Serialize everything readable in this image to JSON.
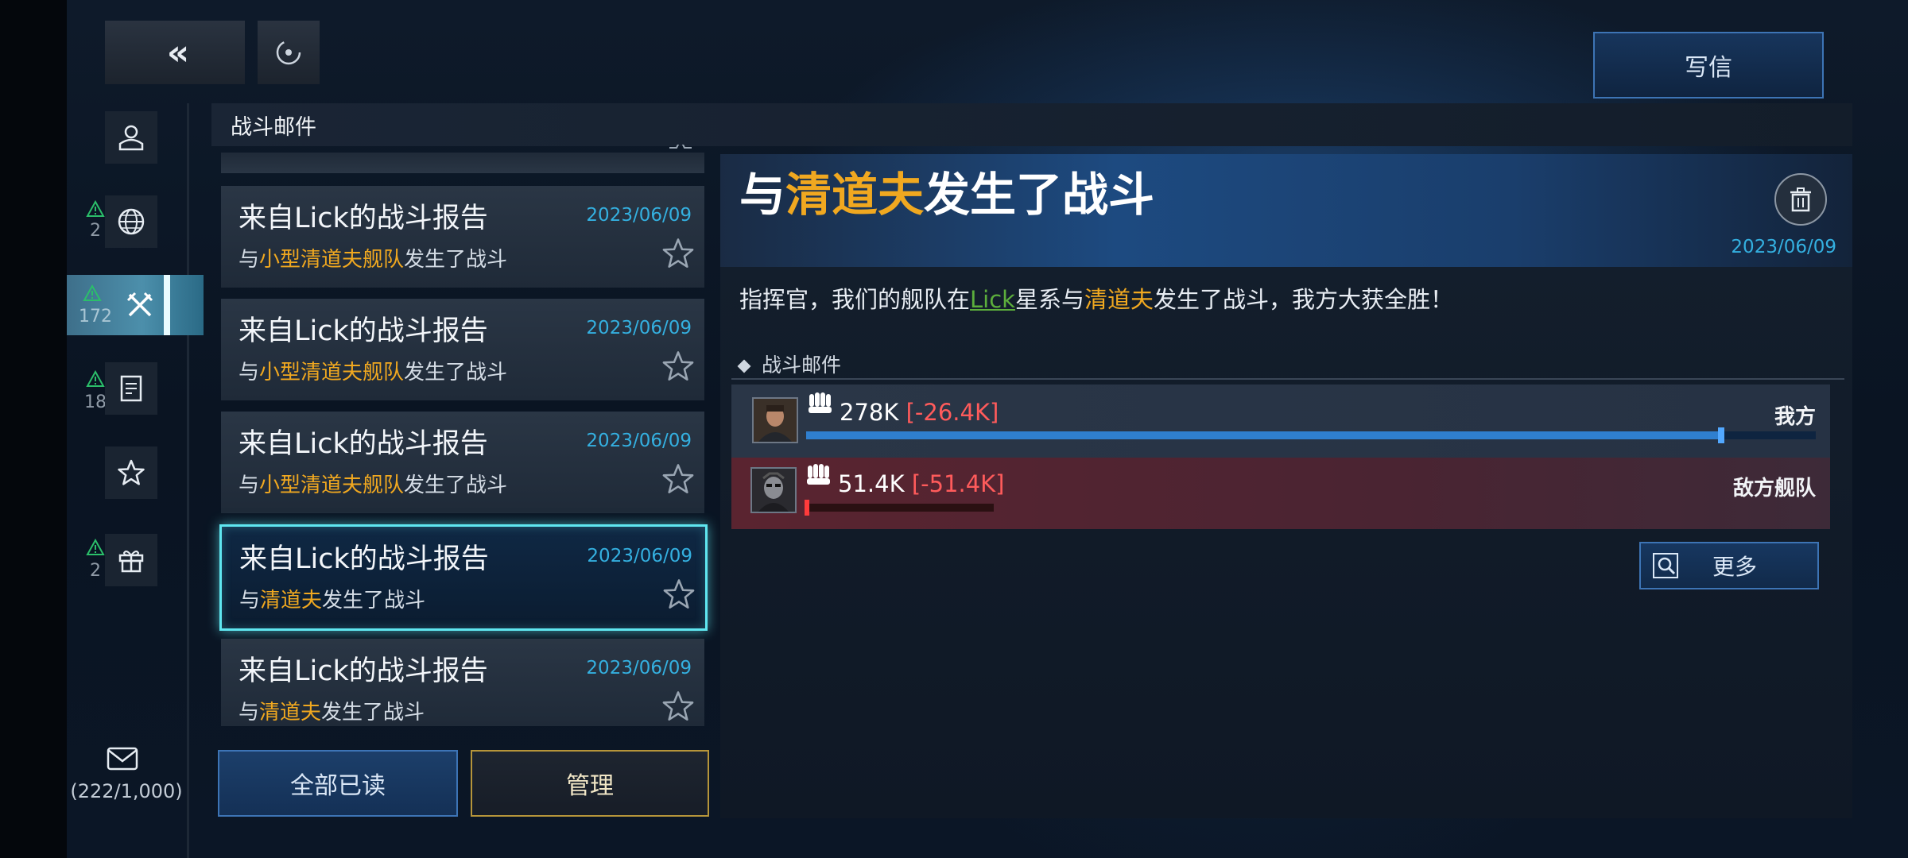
{
  "top": {
    "back_label": "«",
    "write_label": "写信"
  },
  "nav": {
    "badges": [
      {
        "count": "2"
      },
      {
        "count": "172"
      },
      {
        "count": "18"
      },
      {
        "count": "2"
      }
    ],
    "mail_count": "(222/1,000)"
  },
  "header": {
    "title": "战斗邮件"
  },
  "list": [
    {
      "title": "来自Lick的战斗报告",
      "date": "2023/06/09",
      "pre": "与",
      "hl": "小型清道夫舰队",
      "post": "发生了战斗"
    },
    {
      "title": "来自Lick的战斗报告",
      "date": "2023/06/09",
      "pre": "与",
      "hl": "小型清道夫舰队",
      "post": "发生了战斗"
    },
    {
      "title": "来自Lick的战斗报告",
      "date": "2023/06/09",
      "pre": "与",
      "hl": "小型清道夫舰队",
      "post": "发生了战斗"
    },
    {
      "title": "来自Lick的战斗报告",
      "date": "2023/06/09",
      "pre": "与",
      "hl": "清道夫",
      "post": "发生了战斗"
    },
    {
      "title": "来自Lick的战斗报告",
      "date": "2023/06/09",
      "pre": "与",
      "hl": "清道夫",
      "post": "发生了战斗"
    }
  ],
  "buttons": {
    "read_all": "全部已读",
    "manage": "管理",
    "more": "更多"
  },
  "detail": {
    "title_pre": "与",
    "title_hl": "清道夫",
    "title_post": "发生了战斗",
    "date": "2023/06/09",
    "body_1": "指挥官，我们的舰队在",
    "body_link": "Lick",
    "body_2": "星系与",
    "body_hl": "清道夫",
    "body_3": "发生了战斗，我方大获全胜！",
    "section": "战斗邮件"
  },
  "battle": {
    "ally": {
      "power": "278K",
      "loss": "[-26.4K]",
      "label": "我方",
      "remaining_fraction": 0.905
    },
    "enemy": {
      "power": "51.4K",
      "loss": "[-51.4K]",
      "label": "敌方舰队",
      "remaining_fraction": 0.0
    }
  },
  "colors": {
    "highlight": "#f0a820",
    "date": "#34b0e0",
    "loss": "#ff5b5b",
    "selected_border": "#5fe6f0"
  }
}
